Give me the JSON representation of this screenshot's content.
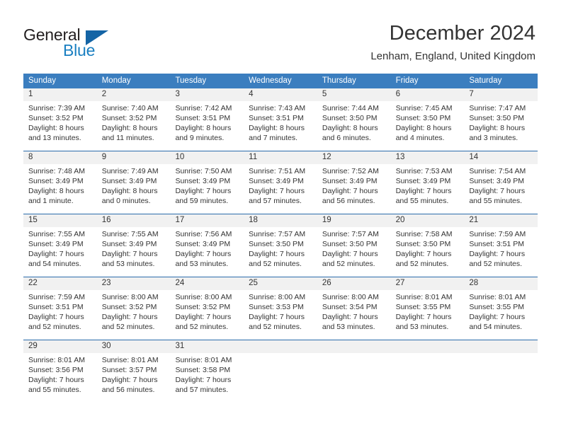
{
  "brand": {
    "name_part1": "General",
    "name_part2": "Blue",
    "logo_icon": "triangle-logo-icon",
    "accent_color": "#1464a5"
  },
  "header": {
    "title": "December 2024",
    "subtitle": "Lenham, England, United Kingdom"
  },
  "calendar": {
    "header_bg": "#3b7ebf",
    "row_divider_color": "#2b6cab",
    "daynum_band_color": "#f1f1f1",
    "weekdays": [
      "Sunday",
      "Monday",
      "Tuesday",
      "Wednesday",
      "Thursday",
      "Friday",
      "Saturday"
    ],
    "weeks": [
      [
        {
          "day": "1",
          "sunrise": "Sunrise: 7:39 AM",
          "sunset": "Sunset: 3:52 PM",
          "daylight1": "Daylight: 8 hours",
          "daylight2": "and 13 minutes."
        },
        {
          "day": "2",
          "sunrise": "Sunrise: 7:40 AM",
          "sunset": "Sunset: 3:52 PM",
          "daylight1": "Daylight: 8 hours",
          "daylight2": "and 11 minutes."
        },
        {
          "day": "3",
          "sunrise": "Sunrise: 7:42 AM",
          "sunset": "Sunset: 3:51 PM",
          "daylight1": "Daylight: 8 hours",
          "daylight2": "and 9 minutes."
        },
        {
          "day": "4",
          "sunrise": "Sunrise: 7:43 AM",
          "sunset": "Sunset: 3:51 PM",
          "daylight1": "Daylight: 8 hours",
          "daylight2": "and 7 minutes."
        },
        {
          "day": "5",
          "sunrise": "Sunrise: 7:44 AM",
          "sunset": "Sunset: 3:50 PM",
          "daylight1": "Daylight: 8 hours",
          "daylight2": "and 6 minutes."
        },
        {
          "day": "6",
          "sunrise": "Sunrise: 7:45 AM",
          "sunset": "Sunset: 3:50 PM",
          "daylight1": "Daylight: 8 hours",
          "daylight2": "and 4 minutes."
        },
        {
          "day": "7",
          "sunrise": "Sunrise: 7:47 AM",
          "sunset": "Sunset: 3:50 PM",
          "daylight1": "Daylight: 8 hours",
          "daylight2": "and 3 minutes."
        }
      ],
      [
        {
          "day": "8",
          "sunrise": "Sunrise: 7:48 AM",
          "sunset": "Sunset: 3:49 PM",
          "daylight1": "Daylight: 8 hours",
          "daylight2": "and 1 minute."
        },
        {
          "day": "9",
          "sunrise": "Sunrise: 7:49 AM",
          "sunset": "Sunset: 3:49 PM",
          "daylight1": "Daylight: 8 hours",
          "daylight2": "and 0 minutes."
        },
        {
          "day": "10",
          "sunrise": "Sunrise: 7:50 AM",
          "sunset": "Sunset: 3:49 PM",
          "daylight1": "Daylight: 7 hours",
          "daylight2": "and 59 minutes."
        },
        {
          "day": "11",
          "sunrise": "Sunrise: 7:51 AM",
          "sunset": "Sunset: 3:49 PM",
          "daylight1": "Daylight: 7 hours",
          "daylight2": "and 57 minutes."
        },
        {
          "day": "12",
          "sunrise": "Sunrise: 7:52 AM",
          "sunset": "Sunset: 3:49 PM",
          "daylight1": "Daylight: 7 hours",
          "daylight2": "and 56 minutes."
        },
        {
          "day": "13",
          "sunrise": "Sunrise: 7:53 AM",
          "sunset": "Sunset: 3:49 PM",
          "daylight1": "Daylight: 7 hours",
          "daylight2": "and 55 minutes."
        },
        {
          "day": "14",
          "sunrise": "Sunrise: 7:54 AM",
          "sunset": "Sunset: 3:49 PM",
          "daylight1": "Daylight: 7 hours",
          "daylight2": "and 55 minutes."
        }
      ],
      [
        {
          "day": "15",
          "sunrise": "Sunrise: 7:55 AM",
          "sunset": "Sunset: 3:49 PM",
          "daylight1": "Daylight: 7 hours",
          "daylight2": "and 54 minutes."
        },
        {
          "day": "16",
          "sunrise": "Sunrise: 7:55 AM",
          "sunset": "Sunset: 3:49 PM",
          "daylight1": "Daylight: 7 hours",
          "daylight2": "and 53 minutes."
        },
        {
          "day": "17",
          "sunrise": "Sunrise: 7:56 AM",
          "sunset": "Sunset: 3:49 PM",
          "daylight1": "Daylight: 7 hours",
          "daylight2": "and 53 minutes."
        },
        {
          "day": "18",
          "sunrise": "Sunrise: 7:57 AM",
          "sunset": "Sunset: 3:50 PM",
          "daylight1": "Daylight: 7 hours",
          "daylight2": "and 52 minutes."
        },
        {
          "day": "19",
          "sunrise": "Sunrise: 7:57 AM",
          "sunset": "Sunset: 3:50 PM",
          "daylight1": "Daylight: 7 hours",
          "daylight2": "and 52 minutes."
        },
        {
          "day": "20",
          "sunrise": "Sunrise: 7:58 AM",
          "sunset": "Sunset: 3:50 PM",
          "daylight1": "Daylight: 7 hours",
          "daylight2": "and 52 minutes."
        },
        {
          "day": "21",
          "sunrise": "Sunrise: 7:59 AM",
          "sunset": "Sunset: 3:51 PM",
          "daylight1": "Daylight: 7 hours",
          "daylight2": "and 52 minutes."
        }
      ],
      [
        {
          "day": "22",
          "sunrise": "Sunrise: 7:59 AM",
          "sunset": "Sunset: 3:51 PM",
          "daylight1": "Daylight: 7 hours",
          "daylight2": "and 52 minutes."
        },
        {
          "day": "23",
          "sunrise": "Sunrise: 8:00 AM",
          "sunset": "Sunset: 3:52 PM",
          "daylight1": "Daylight: 7 hours",
          "daylight2": "and 52 minutes."
        },
        {
          "day": "24",
          "sunrise": "Sunrise: 8:00 AM",
          "sunset": "Sunset: 3:52 PM",
          "daylight1": "Daylight: 7 hours",
          "daylight2": "and 52 minutes."
        },
        {
          "day": "25",
          "sunrise": "Sunrise: 8:00 AM",
          "sunset": "Sunset: 3:53 PM",
          "daylight1": "Daylight: 7 hours",
          "daylight2": "and 52 minutes."
        },
        {
          "day": "26",
          "sunrise": "Sunrise: 8:00 AM",
          "sunset": "Sunset: 3:54 PM",
          "daylight1": "Daylight: 7 hours",
          "daylight2": "and 53 minutes."
        },
        {
          "day": "27",
          "sunrise": "Sunrise: 8:01 AM",
          "sunset": "Sunset: 3:55 PM",
          "daylight1": "Daylight: 7 hours",
          "daylight2": "and 53 minutes."
        },
        {
          "day": "28",
          "sunrise": "Sunrise: 8:01 AM",
          "sunset": "Sunset: 3:55 PM",
          "daylight1": "Daylight: 7 hours",
          "daylight2": "and 54 minutes."
        }
      ],
      [
        {
          "day": "29",
          "sunrise": "Sunrise: 8:01 AM",
          "sunset": "Sunset: 3:56 PM",
          "daylight1": "Daylight: 7 hours",
          "daylight2": "and 55 minutes."
        },
        {
          "day": "30",
          "sunrise": "Sunrise: 8:01 AM",
          "sunset": "Sunset: 3:57 PM",
          "daylight1": "Daylight: 7 hours",
          "daylight2": "and 56 minutes."
        },
        {
          "day": "31",
          "sunrise": "Sunrise: 8:01 AM",
          "sunset": "Sunset: 3:58 PM",
          "daylight1": "Daylight: 7 hours",
          "daylight2": "and 57 minutes."
        },
        {
          "day": "",
          "sunrise": "",
          "sunset": "",
          "daylight1": "",
          "daylight2": ""
        },
        {
          "day": "",
          "sunrise": "",
          "sunset": "",
          "daylight1": "",
          "daylight2": ""
        },
        {
          "day": "",
          "sunrise": "",
          "sunset": "",
          "daylight1": "",
          "daylight2": ""
        },
        {
          "day": "",
          "sunrise": "",
          "sunset": "",
          "daylight1": "",
          "daylight2": ""
        }
      ]
    ]
  }
}
